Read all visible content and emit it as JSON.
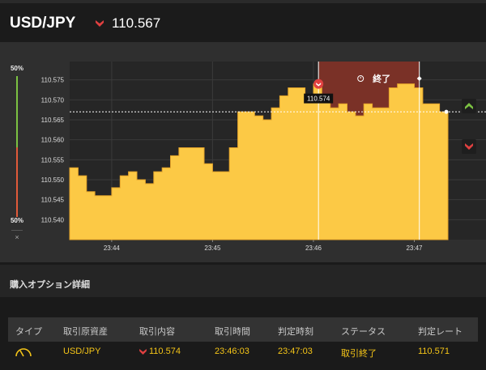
{
  "header": {
    "pair": "USD/JPY",
    "price": "110.567",
    "direction_icon": "down-arrow-icon"
  },
  "ratio": {
    "top": "50%",
    "bottom": "50%",
    "close": "×"
  },
  "chart": {
    "price_labels": [
      "110.575",
      "110.570",
      "110.565",
      "110.560",
      "110.555",
      "110.550",
      "110.545",
      "110.540"
    ],
    "time_labels": [
      "23:44",
      "23:45",
      "23:46",
      "23:47"
    ],
    "entry_tooltip": "110.574",
    "end_label": "終了",
    "fill_color": "#fcc945",
    "zone_color": "#7a3127"
  },
  "chart_data": {
    "type": "area",
    "x": [
      "23:43:35",
      "23:43:40",
      "23:43:45",
      "23:43:50",
      "23:43:55",
      "23:44:00",
      "23:44:05",
      "23:44:10",
      "23:44:15",
      "23:44:20",
      "23:44:25",
      "23:44:30",
      "23:44:35",
      "23:44:40",
      "23:44:45",
      "23:44:50",
      "23:44:55",
      "23:45:00",
      "23:45:05",
      "23:45:10",
      "23:45:15",
      "23:45:20",
      "23:45:25",
      "23:45:30",
      "23:45:35",
      "23:45:40",
      "23:45:45",
      "23:45:50",
      "23:45:55",
      "23:46:00",
      "23:46:05",
      "23:46:10",
      "23:46:15",
      "23:46:20",
      "23:46:25",
      "23:46:30",
      "23:46:35",
      "23:46:40",
      "23:46:45",
      "23:46:50",
      "23:46:55",
      "23:47:00",
      "23:47:05",
      "23:47:10",
      "23:47:15",
      "23:47:20"
    ],
    "y": [
      110.553,
      110.551,
      110.547,
      110.546,
      110.546,
      110.548,
      110.551,
      110.552,
      110.55,
      110.549,
      110.552,
      110.553,
      110.556,
      110.558,
      110.558,
      110.558,
      110.554,
      110.552,
      110.552,
      110.558,
      110.567,
      110.567,
      110.566,
      110.565,
      110.568,
      110.571,
      110.573,
      110.573,
      110.571,
      110.574,
      110.57,
      110.568,
      110.569,
      110.567,
      110.566,
      110.569,
      110.568,
      110.568,
      110.573,
      110.574,
      110.574,
      110.573,
      110.569,
      110.569,
      110.567,
      110.567
    ],
    "xlabel": "",
    "ylabel": "",
    "ylim": [
      110.535,
      110.58
    ],
    "current_price": 110.567,
    "entry_price": 110.574,
    "entry_time": "23:46:03",
    "expiry_time": "23:47:03"
  },
  "section": {
    "title": "購入オプション詳細"
  },
  "table": {
    "headers": [
      "タイプ",
      "取引原資産",
      "取引内容",
      "取引時間",
      "判定時刻",
      "ステータス",
      "判定レート"
    ],
    "row": {
      "type_icon": "gauge-icon",
      "asset": "USD/JPY",
      "direction_icon": "down-arrow-icon",
      "content": "110.574",
      "trade_time": "23:46:03",
      "judge_time": "23:47:03",
      "status": "取引終了",
      "rate": "110.571"
    }
  }
}
